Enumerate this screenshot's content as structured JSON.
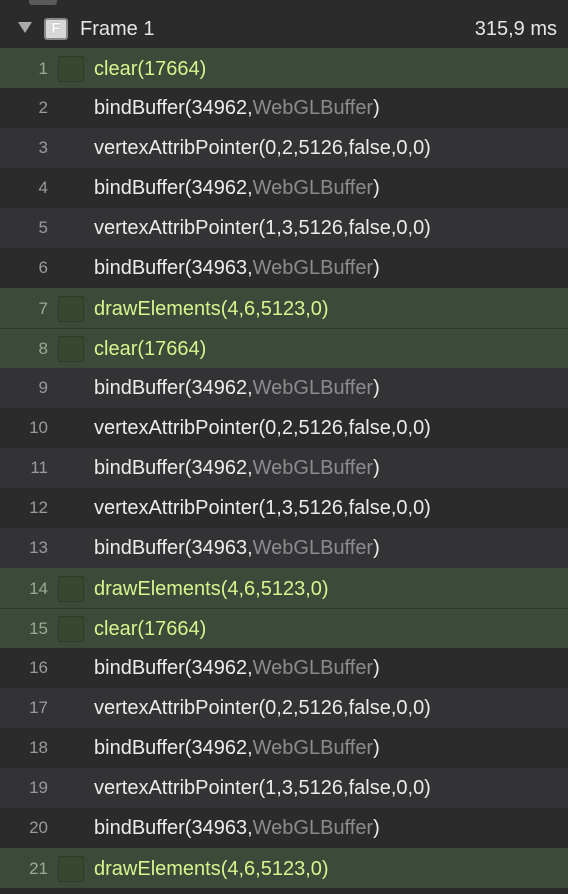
{
  "frame": {
    "title": "Frame 1",
    "time": "315,9 ms",
    "icon_letter": "F"
  },
  "calls": [
    {
      "index": "1",
      "name": "clear(17664)",
      "args": "",
      "obj": "",
      "close": "",
      "draw": true
    },
    {
      "index": "2",
      "name": "bindBuffer(34962,",
      "args": "",
      "obj": "WebGLBuffer",
      "close": ")",
      "draw": false
    },
    {
      "index": "3",
      "name": "vertexAttribPointer(0,2,5126,false,0,0)",
      "args": "",
      "obj": "",
      "close": "",
      "draw": false
    },
    {
      "index": "4",
      "name": "bindBuffer(34962,",
      "args": "",
      "obj": "WebGLBuffer",
      "close": ")",
      "draw": false
    },
    {
      "index": "5",
      "name": "vertexAttribPointer(1,3,5126,false,0,0)",
      "args": "",
      "obj": "",
      "close": "",
      "draw": false
    },
    {
      "index": "6",
      "name": "bindBuffer(34963,",
      "args": "",
      "obj": "WebGLBuffer",
      "close": ")",
      "draw": false
    },
    {
      "index": "7",
      "name": "drawElements(4,6,5123,0)",
      "args": "",
      "obj": "",
      "close": "",
      "draw": true
    },
    {
      "index": "8",
      "name": "clear(17664)",
      "args": "",
      "obj": "",
      "close": "",
      "draw": true
    },
    {
      "index": "9",
      "name": "bindBuffer(34962,",
      "args": "",
      "obj": "WebGLBuffer",
      "close": ")",
      "draw": false
    },
    {
      "index": "10",
      "name": "vertexAttribPointer(0,2,5126,false,0,0)",
      "args": "",
      "obj": "",
      "close": "",
      "draw": false
    },
    {
      "index": "11",
      "name": "bindBuffer(34962,",
      "args": "",
      "obj": "WebGLBuffer",
      "close": ")",
      "draw": false
    },
    {
      "index": "12",
      "name": "vertexAttribPointer(1,3,5126,false,0,0)",
      "args": "",
      "obj": "",
      "close": "",
      "draw": false
    },
    {
      "index": "13",
      "name": "bindBuffer(34963,",
      "args": "",
      "obj": "WebGLBuffer",
      "close": ")",
      "draw": false
    },
    {
      "index": "14",
      "name": "drawElements(4,6,5123,0)",
      "args": "",
      "obj": "",
      "close": "",
      "draw": true
    },
    {
      "index": "15",
      "name": "clear(17664)",
      "args": "",
      "obj": "",
      "close": "",
      "draw": true
    },
    {
      "index": "16",
      "name": "bindBuffer(34962,",
      "args": "",
      "obj": "WebGLBuffer",
      "close": ")",
      "draw": false
    },
    {
      "index": "17",
      "name": "vertexAttribPointer(0,2,5126,false,0,0)",
      "args": "",
      "obj": "",
      "close": "",
      "draw": false
    },
    {
      "index": "18",
      "name": "bindBuffer(34962,",
      "args": "",
      "obj": "WebGLBuffer",
      "close": ")",
      "draw": false
    },
    {
      "index": "19",
      "name": "vertexAttribPointer(1,3,5126,false,0,0)",
      "args": "",
      "obj": "",
      "close": "",
      "draw": false
    },
    {
      "index": "20",
      "name": "bindBuffer(34963,",
      "args": "",
      "obj": "WebGLBuffer",
      "close": ")",
      "draw": false
    },
    {
      "index": "21",
      "name": "drawElements(4,6,5123,0)",
      "args": "",
      "obj": "",
      "close": "",
      "draw": true
    }
  ],
  "colors": {
    "background": "#2b2b2c",
    "alt_row": "#333335",
    "draw_row": "#3c4b39",
    "draw_text": "#d6f58f",
    "text": "#ececec",
    "object_ref": "#8c8c8e"
  }
}
